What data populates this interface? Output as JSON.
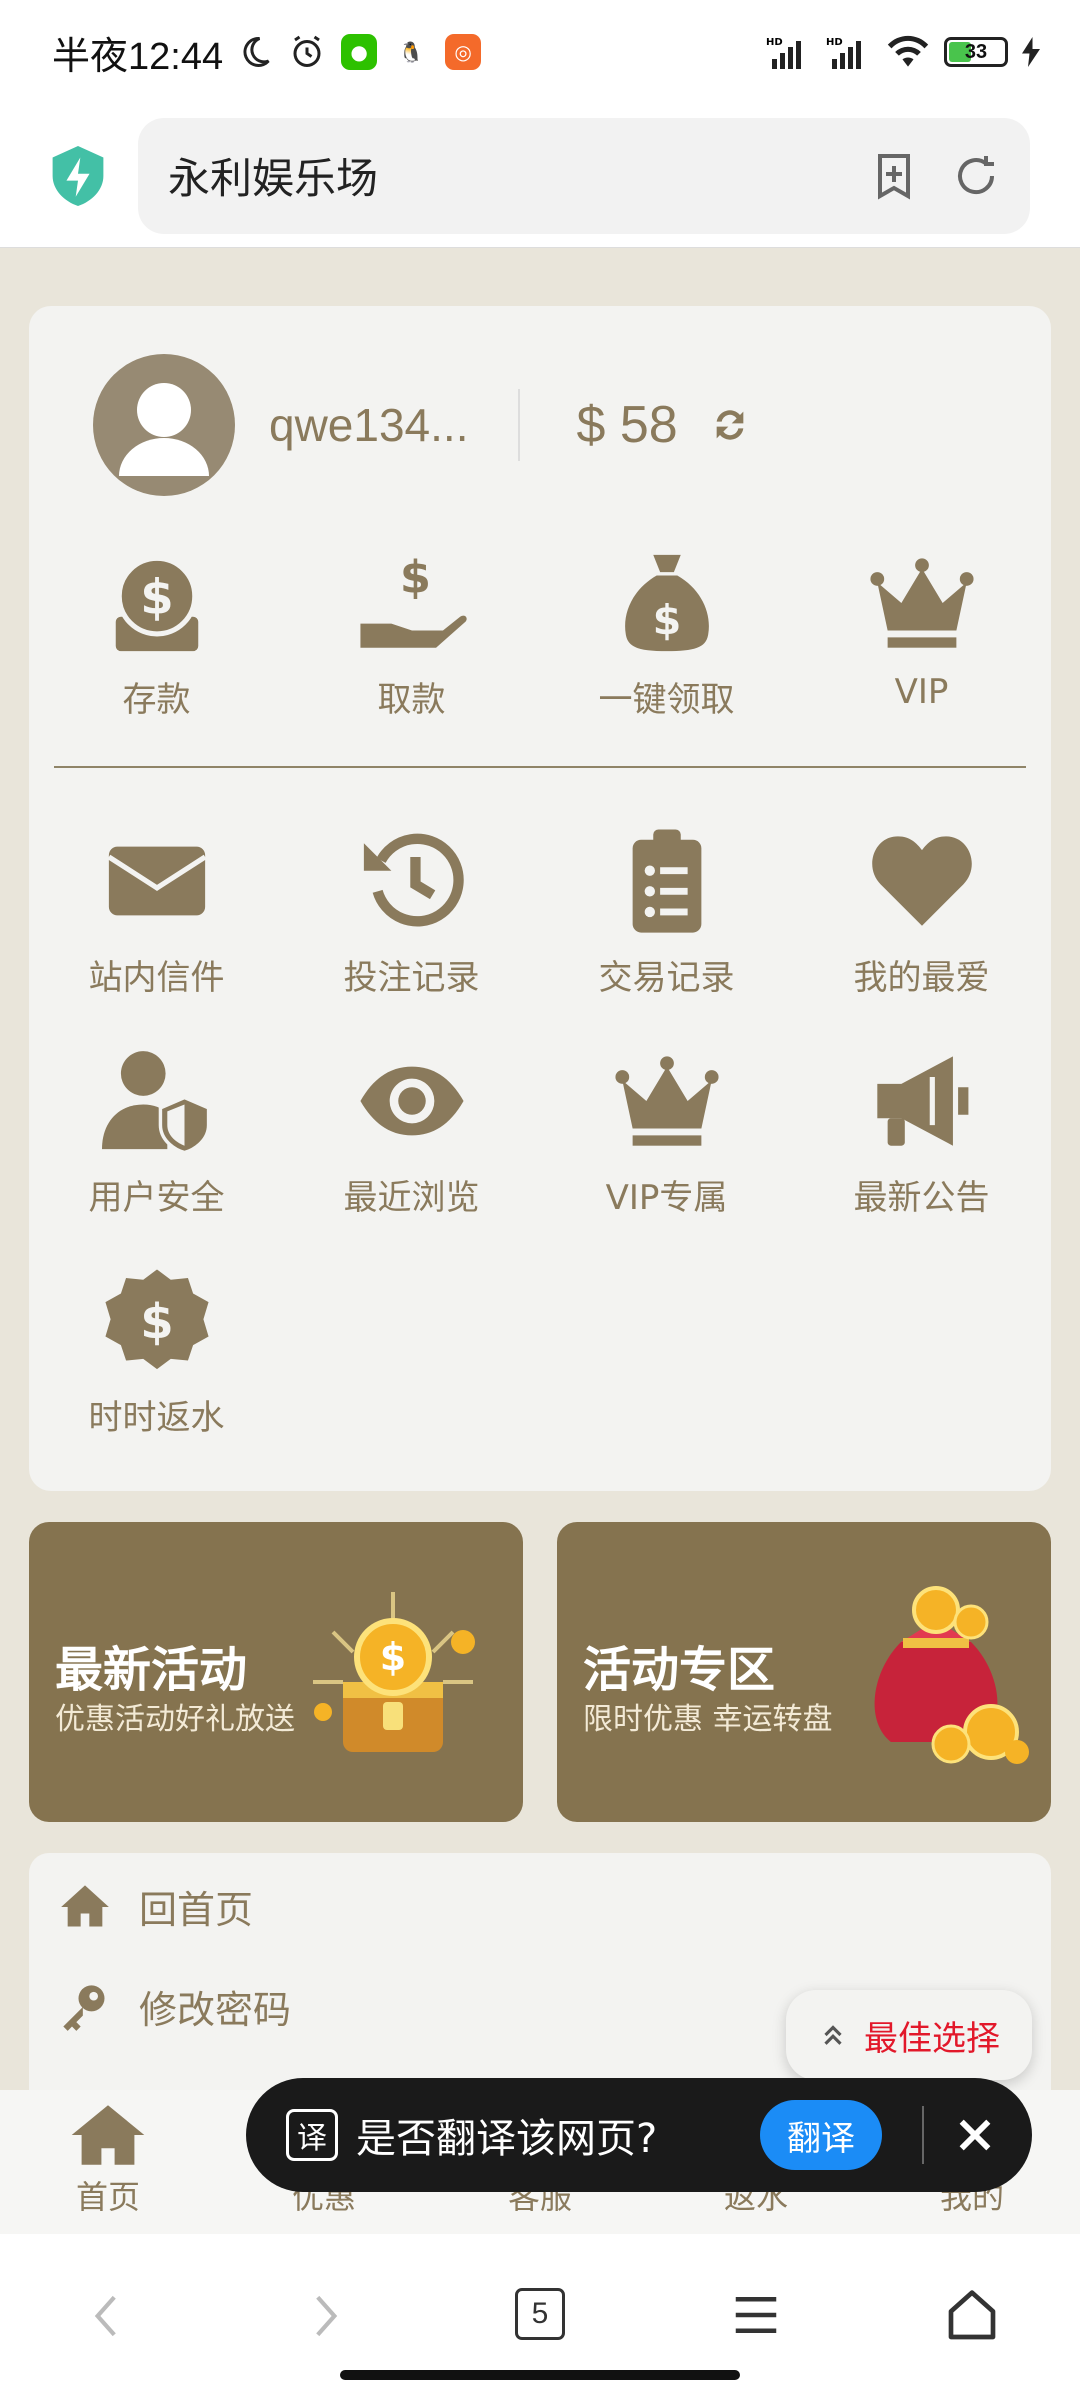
{
  "status_bar": {
    "time": "半夜12:44",
    "battery": "33"
  },
  "url_bar": {
    "title": "永利娱乐场"
  },
  "account": {
    "username": "qwe134...",
    "balance": "$ 58"
  },
  "quick_actions": [
    {
      "label": "存款",
      "icon": "deposit-icon"
    },
    {
      "label": "取款",
      "icon": "withdraw-icon"
    },
    {
      "label": "一键领取",
      "icon": "money-bag-icon"
    },
    {
      "label": "VIP",
      "icon": "crown-icon"
    }
  ],
  "features": [
    {
      "label": "站内信件",
      "icon": "envelope-icon"
    },
    {
      "label": "投注记录",
      "icon": "history-icon"
    },
    {
      "label": "交易记录",
      "icon": "clipboard-icon"
    },
    {
      "label": "我的最爱",
      "icon": "heart-icon"
    },
    {
      "label": "用户安全",
      "icon": "user-shield-icon"
    },
    {
      "label": "最近浏览",
      "icon": "eye-icon"
    },
    {
      "label": "VIP专属",
      "icon": "crown-icon"
    },
    {
      "label": "最新公告",
      "icon": "megaphone-icon"
    },
    {
      "label": "时时返水",
      "icon": "dollar-badge-icon"
    }
  ],
  "promos": [
    {
      "title": "最新活动",
      "subtitle": "优惠活动好礼放送"
    },
    {
      "title": "活动专区",
      "subtitle": "限时优惠 幸运转盘"
    }
  ],
  "menu": [
    {
      "label": "回首页",
      "icon": "home-icon"
    },
    {
      "label": "修改密码",
      "icon": "key-icon"
    }
  ],
  "best_choice": "最佳选择",
  "site_nav": [
    {
      "label": "首页"
    },
    {
      "label": "优惠"
    },
    {
      "label": "客服"
    },
    {
      "label": "返水"
    },
    {
      "label": "我的"
    }
  ],
  "translate_toast": {
    "icon_char": "译",
    "question": "是否翻译该网页?",
    "button": "翻译"
  },
  "browser_nav": {
    "tab_count": "5"
  },
  "colors": {
    "accent": "#85734f",
    "icon": "#8a7a5c",
    "translate_blue": "#1b8cf6",
    "best_red": "#e2182a"
  }
}
